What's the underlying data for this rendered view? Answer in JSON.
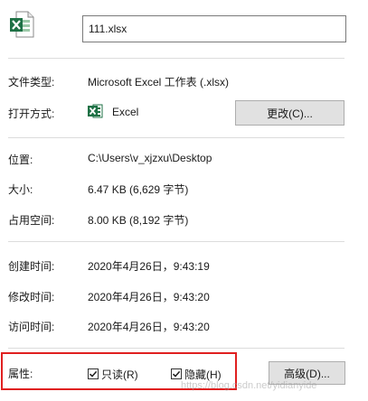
{
  "file": {
    "name": "111.xlsx",
    "icon": "excel-file-icon"
  },
  "type": {
    "label": "文件类型:",
    "value": "Microsoft Excel 工作表 (.xlsx)"
  },
  "opens_with": {
    "label": "打开方式:",
    "app": "Excel",
    "app_icon": "excel-app-icon",
    "change_button": "更改(C)..."
  },
  "location": {
    "label": "位置:",
    "value": "C:\\Users\\v_xjzxu\\Desktop"
  },
  "size": {
    "label": "大小:",
    "value": "6.47 KB (6,629 字节)"
  },
  "size_on_disk": {
    "label": "占用空间:",
    "value": "8.00 KB (8,192 字节)"
  },
  "created": {
    "label": "创建时间:",
    "value": "2020年4月26日，9:43:19"
  },
  "modified": {
    "label": "修改时间:",
    "value": "2020年4月26日，9:43:20"
  },
  "accessed": {
    "label": "访问时间:",
    "value": "2020年4月26日，9:43:20"
  },
  "attributes": {
    "label": "属性:",
    "readonly_label": "只读(R)",
    "readonly_checked": true,
    "hidden_label": "隐藏(H)",
    "hidden_checked": true,
    "advanced_button": "高级(D)..."
  },
  "watermark": "https://blog.csdn.net/yidianyide",
  "colors": {
    "excel_green": "#1e7145",
    "highlight_red": "#e02020"
  }
}
